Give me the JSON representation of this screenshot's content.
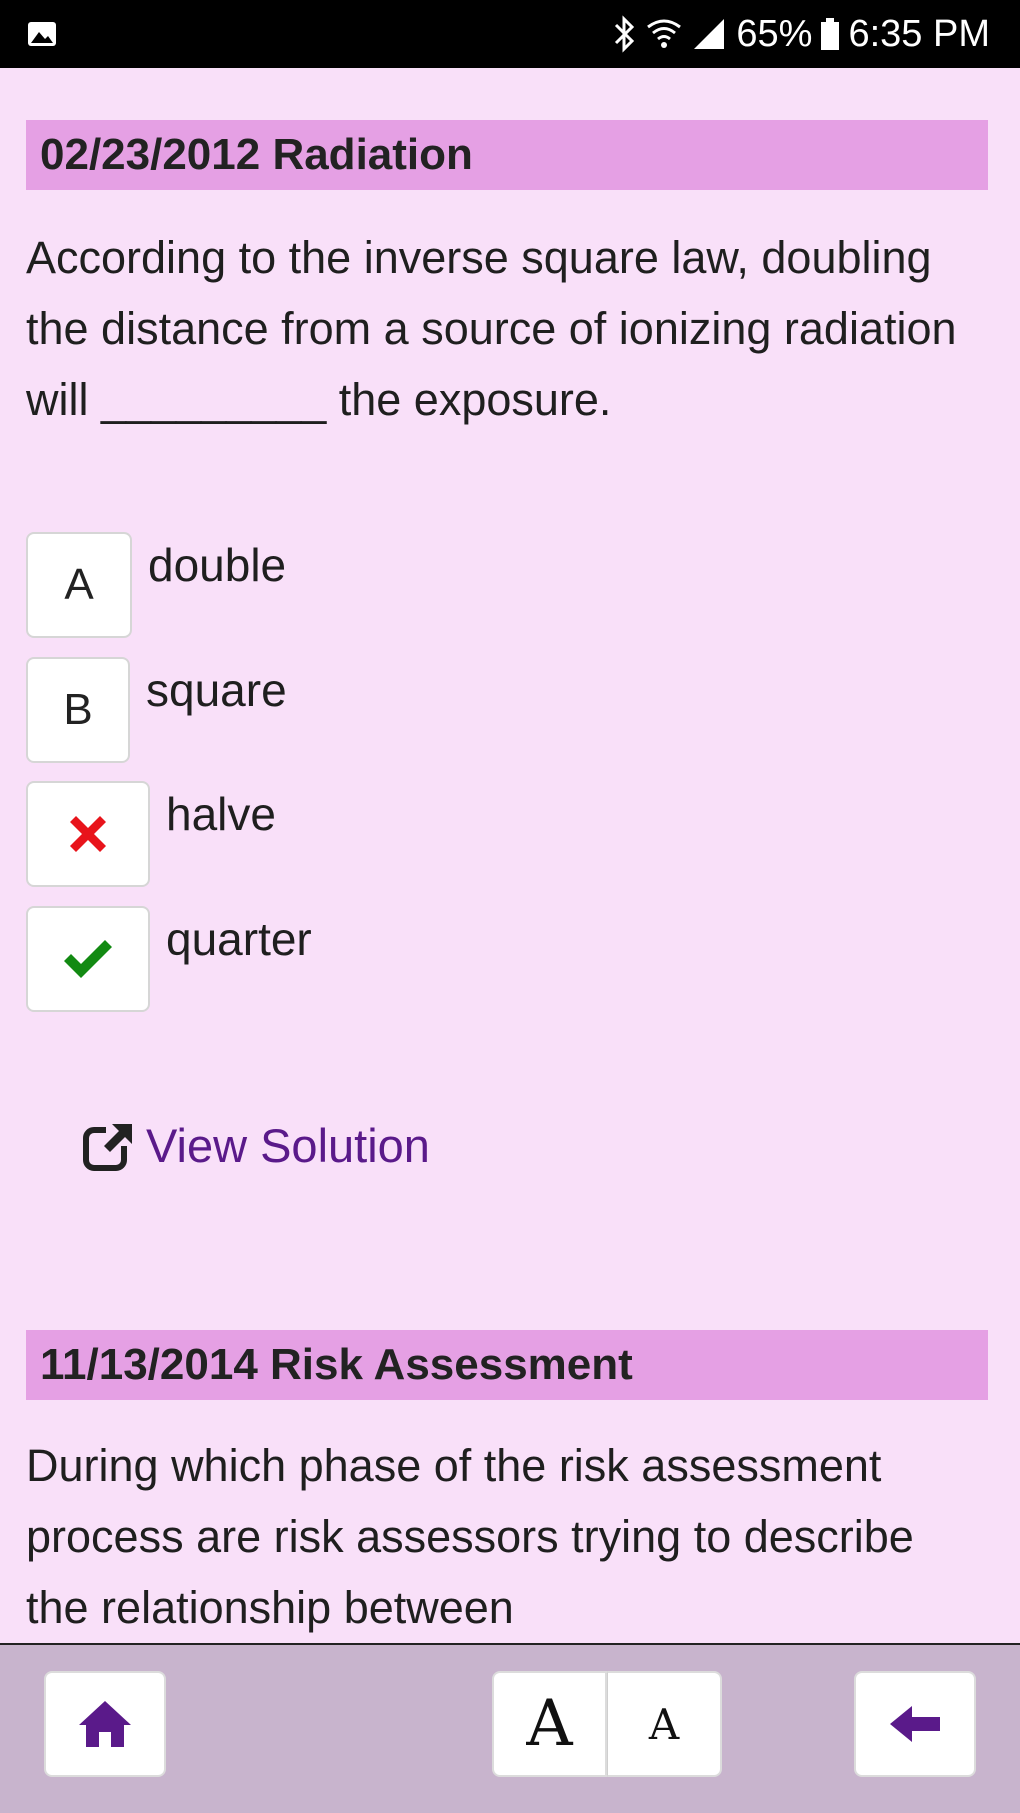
{
  "status_bar": {
    "battery": "65%",
    "time": "6:35 PM",
    "icons": [
      "gallery-icon",
      "bluetooth-icon",
      "wifi-icon",
      "signal-icon",
      "battery-icon"
    ]
  },
  "questions": [
    {
      "header": "02/23/2012 Radiation",
      "text": "According to the inverse square law, doubling the distance from a source of ionizing radiation will _________ the exposure.",
      "options": [
        {
          "marker": "A",
          "label": "double",
          "state": "normal"
        },
        {
          "marker": "B",
          "label": "square",
          "state": "normal"
        },
        {
          "marker": "close-icon",
          "label": "halve",
          "state": "incorrect"
        },
        {
          "marker": "check-icon",
          "label": "quarter",
          "state": "correct"
        }
      ],
      "solution_link": "View Solution"
    },
    {
      "header": "11/13/2014 Risk Assessment",
      "text": "During which phase of the risk assessment process are risk assessors trying to describe the relationship between"
    }
  ],
  "toolbar": {
    "home_icon": "home-icon",
    "font_larger": "A",
    "font_smaller": "A",
    "back_icon": "arrow-left-icon"
  },
  "colors": {
    "background": "#f9e0f9",
    "header": "#e5a0e4",
    "accent": "#5a1a8a",
    "incorrect": "#e8141b",
    "correct": "#128a12",
    "toolbar": "#c8b4cd"
  }
}
